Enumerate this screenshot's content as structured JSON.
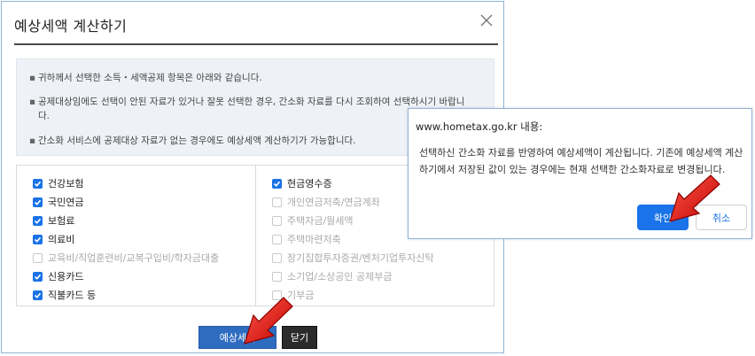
{
  "dialog": {
    "title": "예상세액 계산하기",
    "info": [
      "귀하께서 선택한 소득・세액공제 항목은 아래와 같습니다.",
      "공제대상임에도 선택이 안된 자료가 있거나 잘못 선택한 경우, 간소화 자료를 다시 조회하여 선택하시기 바랍니다.",
      "간소화 서비스에 공제대상 자료가 없는 경우에도 예상세액 계산하기가 가능합니다."
    ],
    "left_items": [
      {
        "label": "건강보험",
        "checked": true
      },
      {
        "label": "국민연금",
        "checked": true
      },
      {
        "label": "보험료",
        "checked": true
      },
      {
        "label": "의료비",
        "checked": true
      },
      {
        "label": "교육비/직업훈련비/교복구입비/학자금대출",
        "checked": false
      },
      {
        "label": "신용카드",
        "checked": true
      },
      {
        "label": "직불카드 등",
        "checked": true
      }
    ],
    "right_items": [
      {
        "label": "현금영수증",
        "checked": true
      },
      {
        "label": "개인연금저축/연금계좌",
        "checked": false
      },
      {
        "label": "주택자금/월세액",
        "checked": false
      },
      {
        "label": "주택마련저축",
        "checked": false
      },
      {
        "label": "장기집합투자증권/벤처기업투자신탁",
        "checked": false
      },
      {
        "label": "소기업/소상공인 공제부금",
        "checked": false
      },
      {
        "label": "기부금",
        "checked": false
      }
    ],
    "calc_button": "예상세액",
    "close_button": "닫기"
  },
  "alert": {
    "origin": "www.hometax.go.kr 내용:",
    "message": "선택하신 간소화 자료를 반영하여 예상세액이 계산됩니다. 기존에 예상세액 계산하기에서 저장된 값이 있는 경우에는 현재 선택한 간소화자료로 변경됩니다.",
    "ok": "확인",
    "cancel": "취소"
  },
  "colors": {
    "accent": "#1a73e8",
    "calc_button": "#2e6cc0",
    "arrow": "#e02020"
  },
  "icons": [
    "close-icon",
    "checkbox-icon",
    "red-arrow-icon"
  ]
}
